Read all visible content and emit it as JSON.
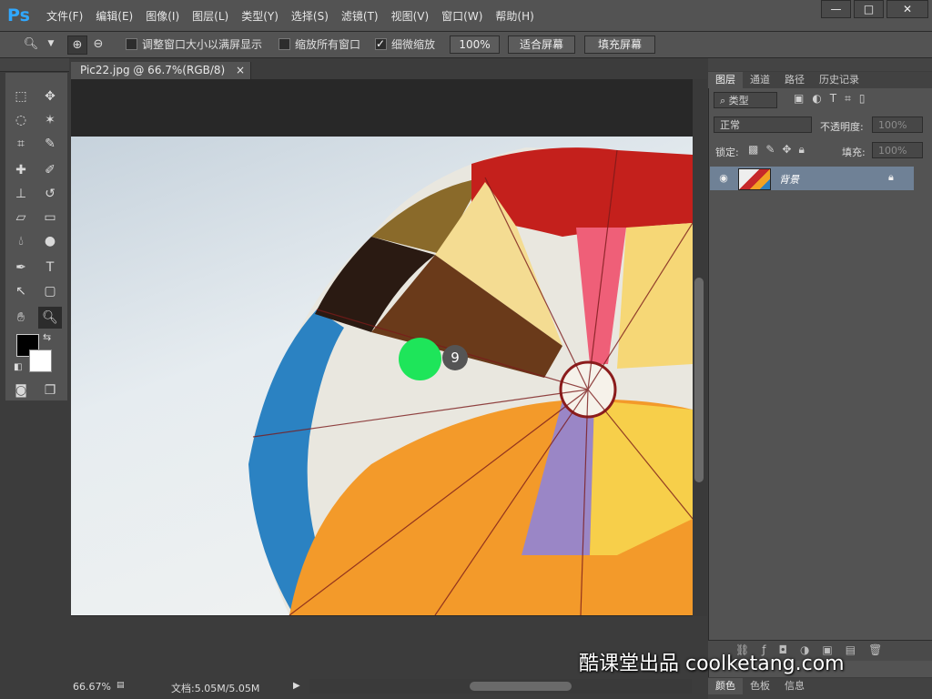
{
  "app": {
    "logo": "Ps"
  },
  "menu": [
    "文件(F)",
    "编辑(E)",
    "图像(I)",
    "图层(L)",
    "类型(Y)",
    "选择(S)",
    "滤镜(T)",
    "视图(V)",
    "窗口(W)",
    "帮助(H)"
  ],
  "window_buttons": {
    "minimize": "—",
    "maximize": "□",
    "close": "✕"
  },
  "options": {
    "resize_windows_label": "调整窗口大小以满屏显示",
    "resize_windows_checked": false,
    "zoom_all_windows_label": "缩放所有窗口",
    "zoom_all_windows_checked": false,
    "scrubby_zoom_label": "细微缩放",
    "scrubby_zoom_checked": true,
    "zoom_100_label": "100%",
    "fit_screen_label": "适合屏幕",
    "fill_screen_label": "填充屏幕"
  },
  "document": {
    "tab_title": "Pic22.jpg @ 66.7%(RGB/8)",
    "tab_close": "×"
  },
  "status": {
    "zoom": "66.67%",
    "doc_size": "文档:5.05M/5.05M"
  },
  "panels": {
    "tabs": [
      "图层",
      "通道",
      "路径",
      "历史记录"
    ],
    "active_tab": "图层",
    "filter_type_label": "类型",
    "blend_mode": "正常",
    "opacity_label": "不透明度:",
    "opacity_value": "100%",
    "lock_label": "锁定:",
    "fill_label": "填充:",
    "fill_value": "100%",
    "layers": [
      {
        "name": "背景",
        "visible": true,
        "locked": true
      }
    ],
    "bottom_tabs": [
      "颜色",
      "色板",
      "信息"
    ]
  },
  "overlay": {
    "step_number": "9",
    "watermark": "酷课堂出品 coolketang.com"
  },
  "colors": {
    "foreground": "#000000",
    "background": "#ffffff",
    "cursor_highlight": "#1ee55a",
    "accent": "#30a8ff"
  }
}
